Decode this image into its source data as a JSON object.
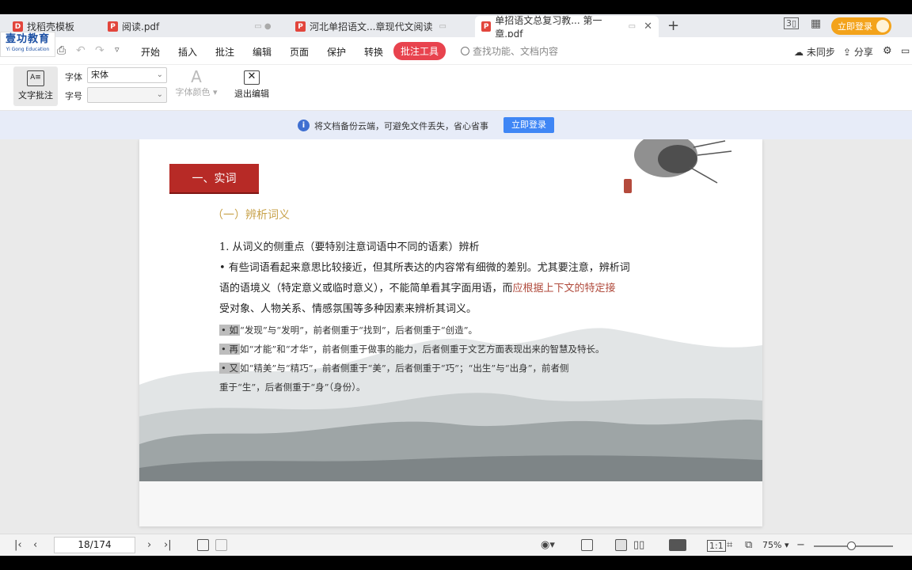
{
  "tabs": [
    {
      "label": "找稻壳模板",
      "active": false
    },
    {
      "label": "阅读.pdf",
      "active": false
    },
    {
      "label": "河北单招语文...章现代文阅读",
      "active": false
    },
    {
      "label": "单招语文总复习教... 第一章.pdf",
      "active": true
    }
  ],
  "header": {
    "login_label": "立即登录"
  },
  "logo": {
    "name": "壹功教育",
    "en": "Yi Gong Education"
  },
  "menu": {
    "items": [
      "开始",
      "插入",
      "批注",
      "编辑",
      "页面",
      "保护",
      "转换"
    ],
    "active_item": "批注工具",
    "search_placeholder": "查找功能、文档内容",
    "sync": "未同步",
    "share": "分享"
  },
  "ribbon": {
    "text_annot": "文字批注",
    "font_label": "字体",
    "font_value": "宋体",
    "size_label": "字号",
    "size_value": "",
    "font_color": "字体颜色",
    "exit_edit": "退出编辑"
  },
  "notice": {
    "text": "将文档备份云端，可避免文件丢失，省心省事",
    "button": "立即登录"
  },
  "document": {
    "section_title": "一、实词",
    "sub_title": "（一）辨析词义",
    "point1": "1. 从词义的侧重点（要特别注意词语中不同的语素）辨析",
    "para_line1": "• 有些词语看起来意思比较接近，但其所表达的内容常有细微的差别。尤其要注意，辨析词",
    "para_line2a": "语的语境义（特定意义或临时意义），不能简单看其字面用语，而",
    "para_line2b": "应根据上下文的特定接",
    "para_line3": "受对象、人物关系、情感氛围等多种因素来辨析其词义。",
    "ex1_mark": "• 如",
    "ex1": "“发现”与“发明”，前者侧重于“找到”，后者侧重于“创造”。",
    "ex2_mark": "• 再",
    "ex2": "如“才能”和“才华”，前者侧重于做事的能力，后者侧重于文艺方面表现出来的智慧及特长。",
    "ex3_mark": "• 又",
    "ex3": "如“精美”与“精巧”，前者侧重于“美”，后者侧重于“巧”；“出生”与“出身”，前者侧",
    "ex3b": "重于“生”，后者侧重于“身”（身份）。"
  },
  "status": {
    "page": "18/174",
    "zoom": "75%"
  },
  "colors": {
    "accent_red": "#e8434e",
    "section_red": "#b72a26",
    "subtitle_gold": "#c8a24a",
    "login_orange": "#f3a31b"
  }
}
